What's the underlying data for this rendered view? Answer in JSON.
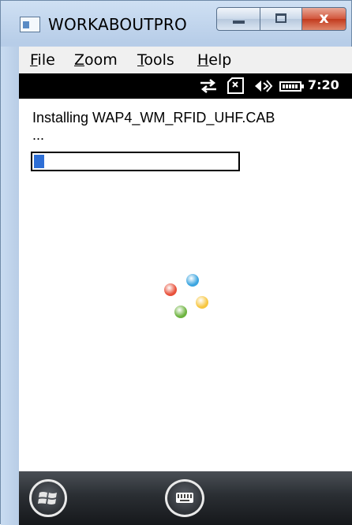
{
  "window": {
    "title": "WORKABOUTPRO",
    "close_symbol": "x"
  },
  "menu": {
    "items": [
      {
        "label": "File",
        "mnemonic": "F",
        "rest": "ile"
      },
      {
        "label": "Zoom",
        "mnemonic": "Z",
        "rest": "oom"
      },
      {
        "label": "Tools",
        "mnemonic": "T",
        "rest": "ools"
      },
      {
        "label": "Help",
        "mnemonic": "H",
        "rest": "elp"
      }
    ]
  },
  "status_bar": {
    "icons": [
      "sync-arrows-icon",
      "no-sim-icon",
      "speaker-icon",
      "battery-icon"
    ],
    "time": "7:20"
  },
  "install": {
    "message": "Installing WAP4_WM_RFID_UHF.CAB",
    "ellipsis": "...",
    "progress_fraction": 0.05
  },
  "spinner": {
    "colors": [
      "#e8503a",
      "#3ba5e0",
      "#f7c640",
      "#6cb33e"
    ]
  },
  "bottom_bar": {
    "icons": [
      "windows-start-icon",
      "keyboard-icon"
    ]
  }
}
